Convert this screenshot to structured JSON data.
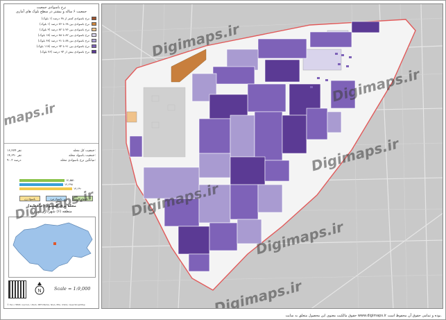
{
  "legend": {
    "title_line1": "نرخ باسوادی جمعیت",
    "title_line2": "جمعیت ۶ ساله و بیشتر در سطح بلوک های آماری",
    "items": [
      {
        "label": "نرخ باسوادی کمتر از ۶۸ درصد (۱ بلوک)",
        "color": "#a0522d"
      },
      {
        "label": "نرخ باسوادی بین ۶۸ تا ۷۶ درصد (۱ بلوک)",
        "color": "#d2883e"
      },
      {
        "label": "نرخ باسوادی بین ۷۶ تا ۸۲ درصد (۳ بلوک)",
        "color": "#f0c28a"
      },
      {
        "label": "نرخ باسوادی بین ۸۲ تا ۸۸ درصد (۱۸ بلوک)",
        "color": "#d9d4ec"
      },
      {
        "label": "نرخ باسوادی بین ۸۸ تا ۹۱ درصد (۶۸ بلوک)",
        "color": "#a99bd1"
      },
      {
        "label": "نرخ باسوادی بین ۹۱ تا ۹۴ درصد (۱۱۸ بلوک)",
        "color": "#7e62b8"
      },
      {
        "label": "نرخ باسوادی بیش از ۹۴ درصد (۷۶ بلوک)",
        "color": "#5b3a94"
      }
    ]
  },
  "stats": [
    {
      "label": "جمعیت کل محله:",
      "value": "۱۶,۲۷۴ نفر"
    },
    {
      "label": "جمعیت باسواد محله:",
      "value": "۱۴,۶۹۰ نفر"
    },
    {
      "label": "میانگین نرخ باسوادی محله:",
      "value": "۹۰.۳ درصد"
    }
  ],
  "bars": [
    {
      "label": "۱۲,۵۵۱",
      "color": "#8bc34a",
      "fraction": 0.72
    },
    {
      "label": "۱۲,۲۹۸",
      "color": "#3aa0d8",
      "fraction": 0.7
    },
    {
      "label": "۱۴,۶۹۰",
      "color": "#f2c94c",
      "fraction": 0.84
    }
  ],
  "categories": [
    {
      "label": "باسواد کل",
      "color": "#8bc34a"
    },
    {
      "label": "باسواد مرد",
      "color": "#7ab8e6"
    },
    {
      "label": "باسواد زن",
      "color": "#f2c94c"
    }
  ],
  "place_title_line1": "محله برق آلستوم (حافظیه)",
  "place_title_line2": "منطقه (۶) شهرداری تهران",
  "scale": "Scale = 1:9,000",
  "credit": "© Esri, HERE, Garmin, USGS, METI/NASA, NGA, EPA, USDA, OpenStreetMap",
  "footer_note": "حقوق مالکیت معنوی این محصول متعلق به سایت www.digimaps.ir بوده و تمامی حقوق آن محفوظ است.",
  "watermark": "Digimaps.ir",
  "watermark_short": "maps.ir",
  "colors": {
    "map_background": "#c9c9c9",
    "neighborhood_fill": "#f4f4f4",
    "boundary": "#e25a5a"
  }
}
